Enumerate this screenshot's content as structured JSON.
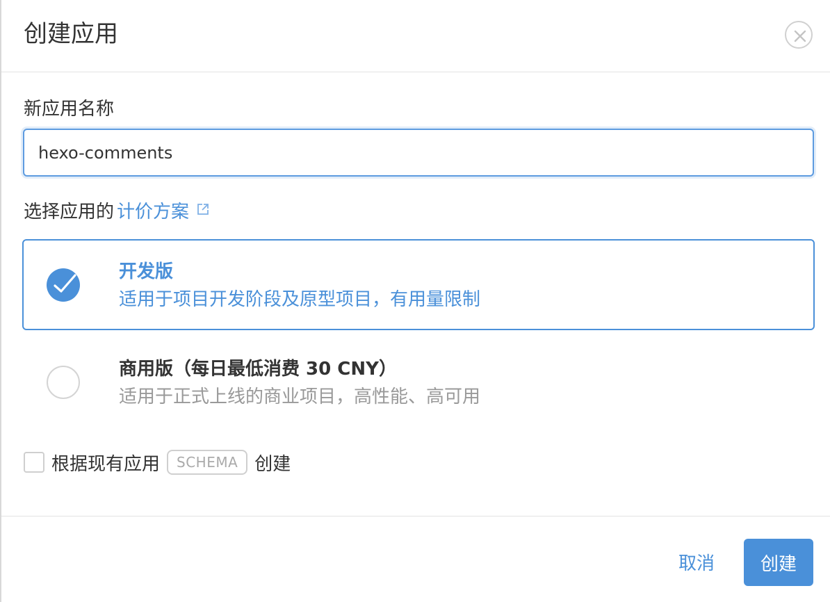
{
  "dialog": {
    "title": "创建应用",
    "close_icon": "close-icon"
  },
  "name_field": {
    "label": "新应用名称",
    "value": "hexo-comments",
    "placeholder": ""
  },
  "plan": {
    "label_prefix": "选择应用的",
    "link_text": "计价方案",
    "link_icon": "external-link-icon",
    "options": [
      {
        "name": "开发版",
        "description": "适用于项目开发阶段及原型项目，有用量限制",
        "selected": true
      },
      {
        "name": "商用版（每日最低消费 30 CNY）",
        "description": "适用于正式上线的商业项目，高性能、高可用",
        "selected": false
      }
    ]
  },
  "schema_option": {
    "prefix": "根据现有应用",
    "badge": "SCHEMA",
    "suffix": "创建",
    "checked": false
  },
  "footer": {
    "cancel_label": "取消",
    "create_label": "创建"
  },
  "colors": {
    "accent": "#4a90d9",
    "muted_text": "#999999",
    "border": "#e3e3e3"
  }
}
